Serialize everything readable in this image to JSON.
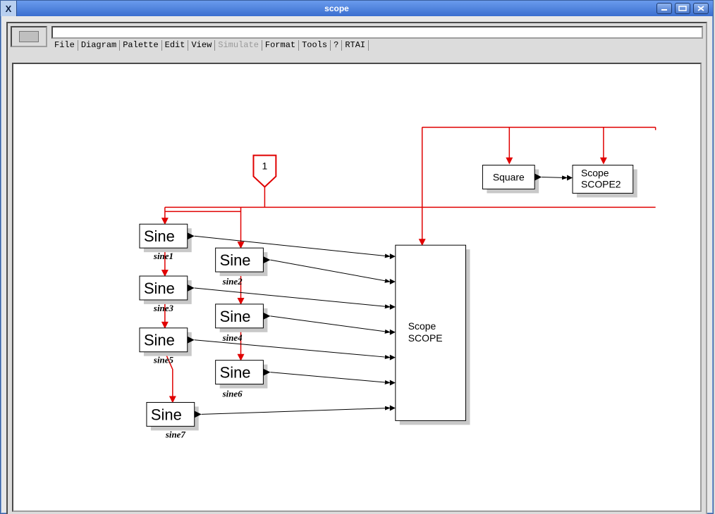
{
  "window": {
    "title": "scope",
    "system_indicator": "X"
  },
  "menubar": {
    "items": [
      {
        "label": "File",
        "disabled": false
      },
      {
        "label": "Diagram",
        "disabled": false
      },
      {
        "label": "Palette",
        "disabled": false
      },
      {
        "label": "Edit",
        "disabled": false
      },
      {
        "label": "View",
        "disabled": false
      },
      {
        "label": "Simulate",
        "disabled": true
      },
      {
        "label": "Format",
        "disabled": false
      },
      {
        "label": "Tools",
        "disabled": false
      },
      {
        "label": "?",
        "disabled": false
      },
      {
        "label": "RTAI",
        "disabled": false
      }
    ]
  },
  "diagram": {
    "clock": {
      "label": "1"
    },
    "sine_blocks": {
      "common_label": "Sine",
      "captions": {
        "sine1": "sine1",
        "sine2": "sine2",
        "sine3": "sine3",
        "sine4": "sine4",
        "sine5": "sine5",
        "sine6": "sine6",
        "sine7": "sine7"
      }
    },
    "scope_main": {
      "line1": "Scope",
      "line2": "SCOPE"
    },
    "square": {
      "label": "Square"
    },
    "scope2": {
      "line1": "Scope",
      "line2": "SCOPE2"
    }
  }
}
